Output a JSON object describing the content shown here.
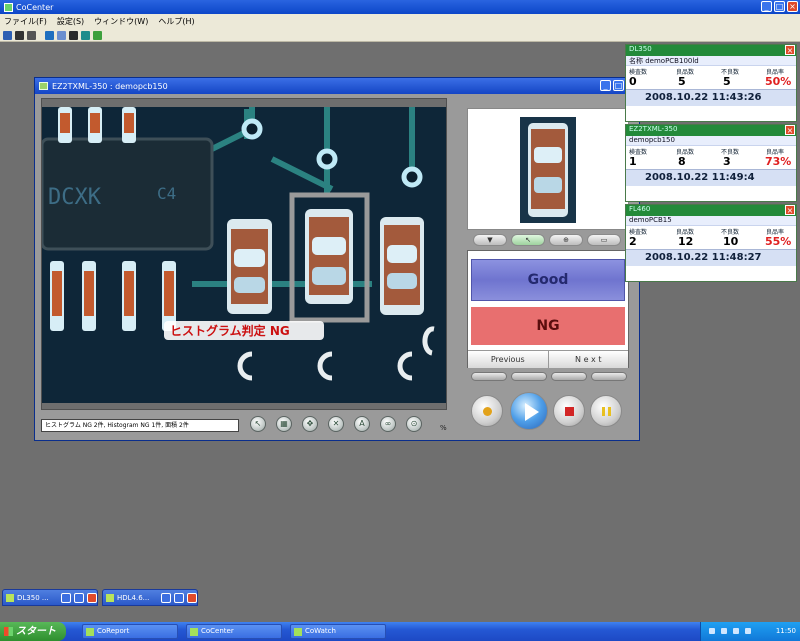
{
  "app": {
    "title": "CoCenter",
    "menu": [
      "ファイル(F)",
      "設定(S)",
      "ウィンドウ(W)",
      "ヘルプ(H)"
    ]
  },
  "camera_window": {
    "title": "EZ2TXML-350 : demopcb150",
    "overlay_text": "ヒストグラム判定 NG",
    "image_labels": {
      "chip": "DCXK",
      "chip_suffix": "C4"
    },
    "status_text": "ヒストグラム NG 2件, Histogram NG 1件, 面積 2件",
    "zoom_label": "%",
    "judge_good": "Good",
    "judge_ng": "NG",
    "previous_label": "Previous",
    "next_label": "N e x t"
  },
  "panels": [
    {
      "header": "DL350",
      "model": "名称 demoPCB100ld",
      "labels": [
        "検査数",
        "良品数",
        "不良数",
        "良品率"
      ],
      "values": [
        "0",
        "5",
        "5",
        "50%"
      ],
      "timestamp": "2008.10.22 11:43:26"
    },
    {
      "header": "EZ2TXML-350",
      "model": "demopcb150",
      "labels": [
        "検査数",
        "良品数",
        "不良数",
        "良品率"
      ],
      "values": [
        "1",
        "8",
        "3",
        "73%"
      ],
      "timestamp": "2008.10.22 11:49:4"
    },
    {
      "header": "FL460",
      "model": "demoPCB15",
      "labels": [
        "検査数",
        "良品数",
        "不良数",
        "良品率"
      ],
      "values": [
        "2",
        "12",
        "10",
        "55%"
      ],
      "timestamp": "2008.10.22 11:48:27"
    }
  ],
  "minimized_windows": [
    "DL350 ...",
    "HDL4.6..."
  ],
  "taskbar": {
    "start_label": "スタート",
    "tasks": [
      "CoReport",
      "CoCenter",
      "CoWatch"
    ],
    "clock": "11:50"
  },
  "colors": {
    "good": "#7a7fd6",
    "ng": "#e86f6f",
    "panel_header": "#238a3a",
    "rate_red": "#e02020"
  }
}
